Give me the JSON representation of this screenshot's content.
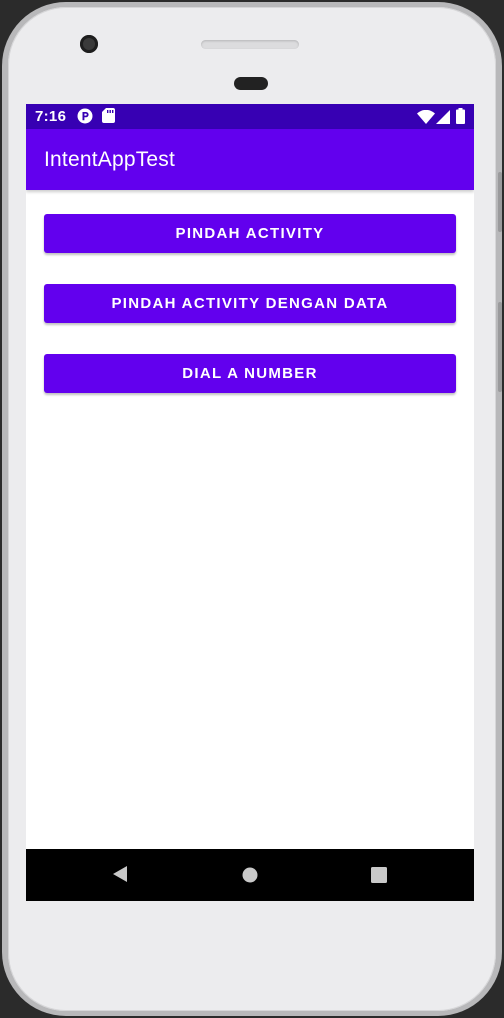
{
  "status_bar": {
    "time": "7:16",
    "left_icons": [
      "parking-icon",
      "sd-card-icon"
    ],
    "right_icons": [
      "wifi-icon",
      "signal-icon",
      "battery-icon"
    ]
  },
  "app_bar": {
    "title": "IntentAppTest"
  },
  "buttons": [
    {
      "label": "PINDAH ACTIVITY"
    },
    {
      "label": "PINDAH ACTIVITY DENGAN DATA"
    },
    {
      "label": "DIAL A NUMBER"
    }
  ],
  "nav_bar": {
    "icons": [
      "back-icon",
      "home-icon",
      "recents-icon"
    ]
  },
  "colors": {
    "primary": "#6200ee",
    "primary_dark": "#3700b3"
  }
}
